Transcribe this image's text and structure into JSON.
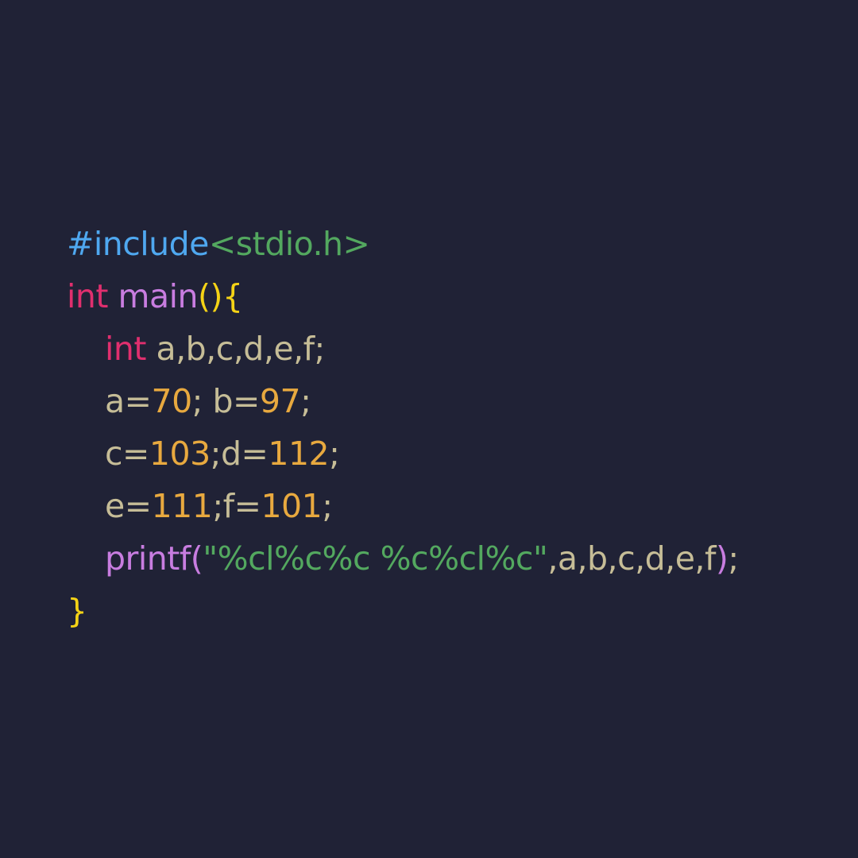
{
  "colors": {
    "background": "#202236",
    "directive": "#4fa8f0",
    "header_name": "#53a85f",
    "keyword": "#e02f6e",
    "function": "#c87de0",
    "bracket": "#f5d316",
    "paren": "#c87de0",
    "identifier": "#c6bd97",
    "number": "#e8a93f",
    "punctuation": "#c6bd97",
    "string": "#53a85f"
  },
  "code": {
    "lines": [
      {
        "indent": 0,
        "tokens": [
          {
            "text": "#include",
            "kind": "directive"
          },
          {
            "text": "<stdio.h>",
            "kind": "header_name"
          }
        ]
      },
      {
        "indent": 0,
        "tokens": [
          {
            "text": "int ",
            "kind": "keyword"
          },
          {
            "text": "main",
            "kind": "function"
          },
          {
            "text": "(){",
            "kind": "bracket"
          }
        ]
      },
      {
        "indent": 1,
        "tokens": [
          {
            "text": "int ",
            "kind": "keyword"
          },
          {
            "text": "a,b,c,d,e,f;",
            "kind": "identifier"
          }
        ]
      },
      {
        "indent": 1,
        "tokens": [
          {
            "text": "a=",
            "kind": "identifier"
          },
          {
            "text": "70",
            "kind": "number"
          },
          {
            "text": "; b=",
            "kind": "identifier"
          },
          {
            "text": "97",
            "kind": "number"
          },
          {
            "text": ";",
            "kind": "punctuation"
          }
        ]
      },
      {
        "indent": 1,
        "tokens": [
          {
            "text": "c=",
            "kind": "identifier"
          },
          {
            "text": "103",
            "kind": "number"
          },
          {
            "text": ";d=",
            "kind": "identifier"
          },
          {
            "text": "112",
            "kind": "number"
          },
          {
            "text": ";",
            "kind": "punctuation"
          }
        ]
      },
      {
        "indent": 1,
        "tokens": [
          {
            "text": "e=",
            "kind": "identifier"
          },
          {
            "text": "111",
            "kind": "number"
          },
          {
            "text": ";f=",
            "kind": "identifier"
          },
          {
            "text": "101",
            "kind": "number"
          },
          {
            "text": ";",
            "kind": "punctuation"
          }
        ]
      },
      {
        "indent": 1,
        "tokens": [
          {
            "text": "printf",
            "kind": "function"
          },
          {
            "text": "(",
            "kind": "paren"
          },
          {
            "text": "\"%cl%c%c %c%cl%c\"",
            "kind": "string"
          },
          {
            "text": ",a,b,c,d,e,f",
            "kind": "identifier"
          },
          {
            "text": ")",
            "kind": "paren"
          },
          {
            "text": ";",
            "kind": "punctuation"
          }
        ]
      },
      {
        "indent": 0,
        "tokens": [
          {
            "text": "}",
            "kind": "bracket"
          }
        ]
      }
    ]
  }
}
